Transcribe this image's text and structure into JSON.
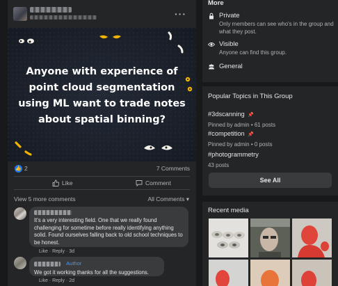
{
  "post": {
    "menu_label": "···",
    "image_text": "Anyone with experience of point cloud segmentation using ML want to trade notes about spatial binning?",
    "reaction_count": "2",
    "comments_count": "7 Comments",
    "like_label": "Like",
    "comment_label": "Comment",
    "view_more_label": "View 5 more comments",
    "all_comments_label": "All Comments",
    "like_icon": "thumbs-up-icon",
    "comment_icon": "speech-bubble-icon"
  },
  "comments": [
    {
      "text": "It's a very interesting field. One that we really found challenging for sometime before really identifying anything solid. Found ourselves falling back to old school techniques to be honest.",
      "like": "Like",
      "reply": "Reply",
      "time": "3d",
      "badge": "📦"
    },
    {
      "badge_label": "Author",
      "text": "We got it working thanks for all the suggestions.",
      "like": "Like",
      "reply": "Reply",
      "time": "2d"
    }
  ],
  "about": {
    "title": "More",
    "private_title": "Private",
    "private_desc": "Only members can see who's in the group and what they post.",
    "visible_title": "Visible",
    "visible_desc": "Anyone can find this group.",
    "general_label": "General"
  },
  "topics": {
    "header": "Popular Topics in This Group",
    "items": [
      {
        "name": "#3dscanning",
        "info": "Pinned by admin • 61 posts",
        "pinned": true
      },
      {
        "name": "#competition",
        "info": "Pinned by admin • 0 posts",
        "pinned": true
      },
      {
        "name": "#photogrammetry",
        "info": "43 posts",
        "pinned": false
      }
    ],
    "see_all_label": "See All"
  },
  "media": {
    "header": "Recent media"
  },
  "colors": {
    "page_bg": "#18191a",
    "card_bg": "#242526",
    "bubble_bg": "#3a3b3c",
    "accent_blue": "#2078f4",
    "author_blue": "#4599ff",
    "poster_bg": "#1e2430"
  }
}
